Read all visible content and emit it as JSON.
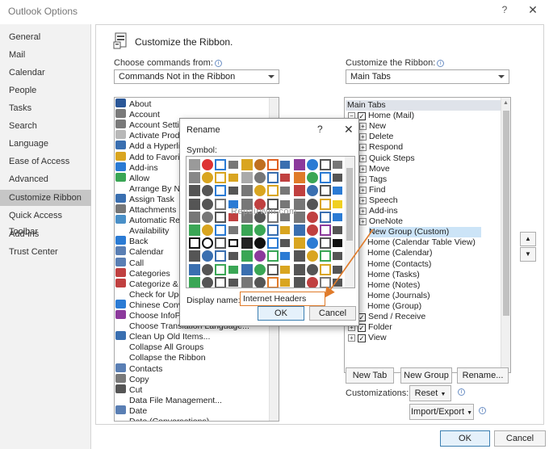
{
  "window": {
    "title": "Outlook Options",
    "help": "?",
    "close": "✕"
  },
  "nav": {
    "items": [
      "General",
      "Mail",
      "Calendar",
      "People",
      "Tasks",
      "Search",
      "Language",
      "Ease of Access",
      "Advanced",
      "Customize Ribbon",
      "Quick Access Toolbar",
      "Add-ins",
      "Trust Center"
    ],
    "active": "Customize Ribbon"
  },
  "heading": "Customize the Ribbon.",
  "left": {
    "label": "Choose commands from:",
    "combo": "Commands Not in the Ribbon",
    "commands": [
      {
        "text": "About",
        "color": "#2b5797"
      },
      {
        "text": "Account",
        "color": "#7a7a7a"
      },
      {
        "text": "Account Settin",
        "color": "#7a7a7a"
      },
      {
        "text": "Activate Produ",
        "color": "#b8b8b8"
      },
      {
        "text": "Add a Hyperlin",
        "color": "#3a6fb0"
      },
      {
        "text": "Add to Favorite",
        "color": "#d9a520"
      },
      {
        "text": "Add-ins",
        "color": "#2b7bd4"
      },
      {
        "text": "Allow",
        "color": "#3aa655"
      },
      {
        "text": "Arrange By Na",
        "color": "#ffffff"
      },
      {
        "text": "Assign Task",
        "color": "#3a6fb0"
      },
      {
        "text": "Attachments",
        "color": "#777777"
      },
      {
        "text": "Automatic Rep",
        "color": "#4a90c8"
      },
      {
        "text": "Availability",
        "color": "#ffffff"
      },
      {
        "text": "Back",
        "color": "#2b7bd4"
      },
      {
        "text": "Calendar",
        "color": "#5a7fb4"
      },
      {
        "text": "Call",
        "color": "#5a7fb4"
      },
      {
        "text": "Categories",
        "color": "#c04040"
      },
      {
        "text": "Categorize & M",
        "color": "#c04040"
      },
      {
        "text": "Check for Upd",
        "color": "#ffffff"
      },
      {
        "text": "Chinese Conve",
        "color": "#2b7bd4"
      },
      {
        "text": "Choose InfoPa",
        "color": "#8c3a9c"
      },
      {
        "text": "Choose Translation Language...",
        "color": "#ffffff"
      },
      {
        "text": "Clean Up Old Items...",
        "color": "#3a6fb0"
      },
      {
        "text": "Collapse All Groups",
        "color": "#ffffff"
      },
      {
        "text": "Collapse the Ribbon",
        "color": "#ffffff"
      },
      {
        "text": "Contacts",
        "color": "#5a7fb4"
      },
      {
        "text": "Copy",
        "color": "#7a7a7a"
      },
      {
        "text": "Cut",
        "color": "#555555"
      },
      {
        "text": "Data File Management...",
        "color": "#ffffff"
      },
      {
        "text": "Date",
        "color": "#5a7fb4"
      },
      {
        "text": "Date (Conversations)",
        "color": "#ffffff"
      }
    ]
  },
  "right": {
    "label": "Customize the Ribbon:",
    "combo": "Main Tabs",
    "tree": [
      {
        "text": "Main Tabs",
        "header": true
      },
      {
        "text": "Home (Mail)",
        "pm": "⊟",
        "cb": true,
        "indent": 0
      },
      {
        "text": "New",
        "pm": "⊞",
        "indent": 1
      },
      {
        "text": "Delete",
        "pm": "⊞",
        "indent": 1
      },
      {
        "text": "Respond",
        "pm": "⊞",
        "indent": 1
      },
      {
        "text": "Quick Steps",
        "pm": "⊞",
        "indent": 1
      },
      {
        "text": "Move",
        "pm": "⊞",
        "indent": 1
      },
      {
        "text": "Tags",
        "pm": "⊞",
        "indent": 1
      },
      {
        "text": "Find",
        "pm": "⊞",
        "indent": 1
      },
      {
        "text": "Speech",
        "pm": "⊞",
        "indent": 1
      },
      {
        "text": "Add-ins",
        "pm": "⊞",
        "indent": 1
      },
      {
        "text": "OneNote",
        "pm": "⊞",
        "indent": 1
      },
      {
        "text": "New Group (Custom)",
        "indent": 2,
        "selected": true
      },
      {
        "text": "Home (Calendar Table View)",
        "indent": 0
      },
      {
        "text": "Home (Calendar)",
        "indent": 0
      },
      {
        "text": "Home (Contacts)",
        "indent": 0
      },
      {
        "text": "Home (Tasks)",
        "indent": 0
      },
      {
        "text": "Home (Notes)",
        "indent": 0
      },
      {
        "text": "Home (Journals)",
        "indent": 0
      },
      {
        "text": "Home (Group)",
        "indent": 0
      },
      {
        "text": "Send / Receive",
        "pm": "⊞",
        "cb": true,
        "indent": 0
      },
      {
        "text": "Folder",
        "pm": "⊞",
        "cb": true,
        "indent": 0
      },
      {
        "text": "View",
        "pm": "⊞",
        "cb": true,
        "indent": 0
      }
    ],
    "new_tab": "New Tab",
    "new_group": "New Group",
    "rename": "Rename...",
    "customizations_label": "Customizations:",
    "reset": "Reset",
    "import_export": "Import/Export"
  },
  "dialog": {
    "title": "Rename",
    "help": "?",
    "close": "✕",
    "symbol_label": "Symbol:",
    "display_name_label": "Display name:",
    "display_name_value": "Internet Headers",
    "ok": "OK",
    "cancel": "Cancel"
  },
  "symbols": [
    "#9a9a9a",
    "#d33",
    "#2b7bd4",
    "#777",
    "#d9a520",
    "#c07020",
    "#e06020",
    "#3a6fb0",
    "#8c3a9c",
    "#2b7bd4",
    "#555",
    "#777",
    "#888",
    "#d9a520",
    "#d9a520",
    "#d9a520",
    "#aaa",
    "#777",
    "#3a6fb0",
    "#c04040",
    "#e07b2a",
    "#3aa655",
    "#2b7bd4",
    "#555",
    "#555",
    "#555",
    "#2b7bd4",
    "#555",
    "#777",
    "#d9a520",
    "#d9a520",
    "#777",
    "#c04040",
    "#3a6fb0",
    "#555",
    "#2b7bd4",
    "#555",
    "#555",
    "#777",
    "#2b7bd4",
    "#777",
    "#c04040",
    "#555",
    "#777",
    "#777",
    "#555",
    "#d9a520",
    "#f0d020",
    "#777",
    "#777",
    "#555",
    "#c04040",
    "#777",
    "#555",
    "#777",
    "#777",
    "#777",
    "#c04040",
    "#3a6fb0",
    "#2b7bd4",
    "#3aa655",
    "#d9a520",
    "#2b7bd4",
    "#777",
    "#3aa655",
    "#3aa655",
    "#3a6fb0",
    "#d9a520",
    "#3a6fb0",
    "#c04040",
    "#8c3a9c",
    "#555",
    "#111",
    "#111",
    "#555",
    "#111",
    "#222",
    "#111",
    "#2b7bd4",
    "#555",
    "#d9a520",
    "#2b7bd4",
    "#555",
    "#111",
    "#555",
    "#3a6fb0",
    "#3a6fb0",
    "#555",
    "#3aa655",
    "#8c3a9c",
    "#3aa655",
    "#2b7bd4",
    "#555",
    "#d9a520",
    "#3aa655",
    "#555",
    "#3a6fb0",
    "#555",
    "#3aa655",
    "#3aa655",
    "#3a6fb0",
    "#3aa655",
    "#555",
    "#d9a520",
    "#555",
    "#555",
    "#d9a520",
    "#555",
    "#3aa655",
    "#555",
    "#555",
    "#555",
    "#777",
    "#555",
    "#e07b2a",
    "#d9a520",
    "#555",
    "#c04040",
    "#777",
    "#555"
  ],
  "watermark": "RepairWin.com",
  "footer": {
    "ok": "OK",
    "cancel": "Cancel"
  }
}
